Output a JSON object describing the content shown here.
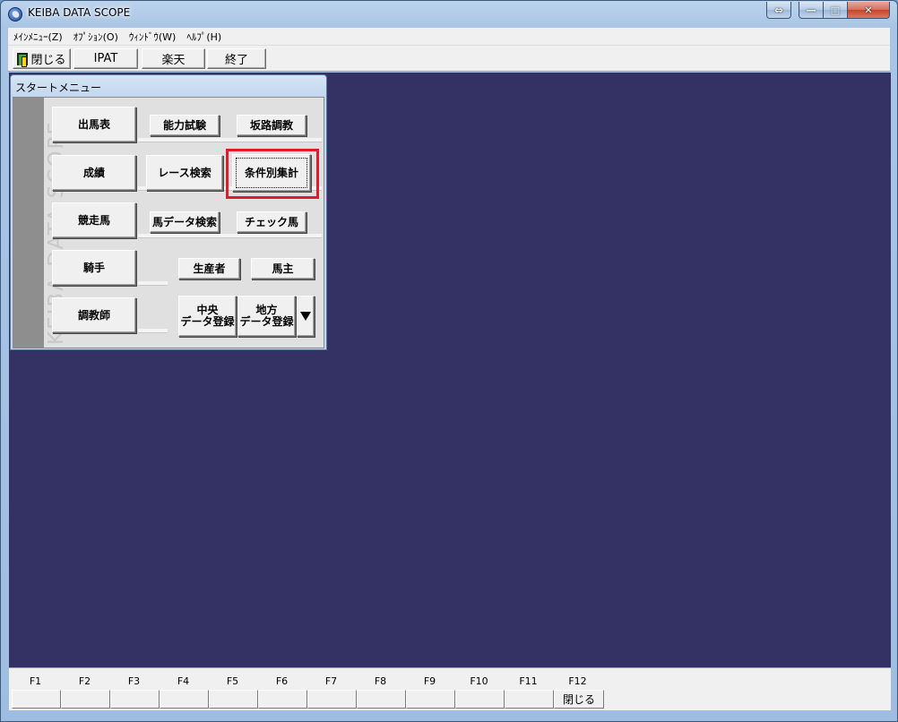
{
  "window": {
    "title": "KEIBA DATA SCOPE",
    "caption_buttons": {
      "swap": "⇔",
      "minimize": "—",
      "maximize": "□",
      "close": "✕"
    }
  },
  "menubar": {
    "items": [
      "ﾒｲﾝﾒﾆｭｰ(Z)",
      "ｵﾌﾟｼｮﾝ(O)",
      "ｳｨﾝﾄﾞｳ(W)",
      "ﾍﾙﾌﾟ(H)"
    ]
  },
  "toolbar": {
    "close_label": "閉じる",
    "ipat_label": "IPAT",
    "rakuten_label": "楽天",
    "exit_label": "終了"
  },
  "start_menu": {
    "title": "スタートメニュー",
    "brand": "KEIBA DATA SCOPE",
    "left_buttons": [
      "出馬表",
      "成績",
      "競走馬",
      "騎手",
      "調教師"
    ],
    "row1": [
      "能力試験",
      "坂路調教"
    ],
    "row2": [
      "レース検索",
      "条件別集計"
    ],
    "row3": [
      "馬データ検索",
      "チェック馬"
    ],
    "row4": [
      "生産者",
      "馬主"
    ],
    "row5": {
      "chuo_line1": "中央",
      "chuo_line2": "データ登録",
      "chiho_line1": "地方",
      "chiho_line2": "データ登録"
    },
    "highlight_color": "#e11b2b"
  },
  "fkeys": {
    "labels": [
      "F1",
      "F2",
      "F3",
      "F4",
      "F5",
      "F6",
      "F7",
      "F8",
      "F9",
      "F10",
      "F11",
      "F12"
    ],
    "f12_action": "閉じる"
  },
  "colors": {
    "mdi_background": "#343265",
    "button_face": "#f0f0f0"
  }
}
